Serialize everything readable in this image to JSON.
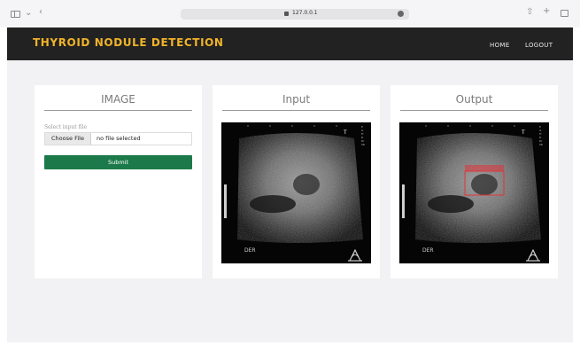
{
  "browser": {
    "url": "127.0.0.1",
    "icons": [
      "sidebar-icon",
      "chevron-down-icon",
      "back-icon",
      "lock-icon",
      "reload-icon",
      "share-icon",
      "plus-icon",
      "tabs-icon"
    ]
  },
  "nav": {
    "brand": "THYROID NODULE DETECTION",
    "links": [
      "HOME",
      "LOGOUT"
    ]
  },
  "cards": {
    "image": {
      "title": "IMAGE",
      "file_label": "Select input file",
      "choose_button": "Choose File",
      "file_status": "no file selected",
      "submit": "Submit"
    },
    "input": {
      "title": "Input",
      "scan_top_label": "T",
      "scan_bottom_label": "DER"
    },
    "output": {
      "title": "Output",
      "scan_top_label": "T",
      "scan_bottom_label": "DER"
    }
  },
  "colors": {
    "navbar": "#232222",
    "brand": "#f0b429",
    "submit": "#1c7a4a",
    "detection_box": "#e0333a"
  }
}
